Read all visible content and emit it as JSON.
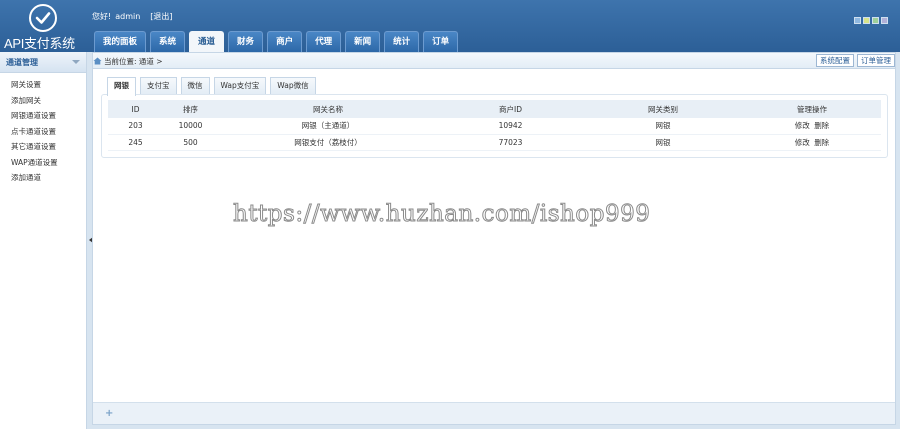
{
  "header": {
    "logo_text": "API支付系统",
    "greeting": "您好!",
    "username": "admin",
    "logout_label": "[退出]",
    "skin_colors": [
      "#8fb8e0",
      "#d8e48a",
      "#9fd09a",
      "#b0b0d8"
    ]
  },
  "nav": {
    "tabs": [
      {
        "label": "我的面板"
      },
      {
        "label": "系统"
      },
      {
        "label": "通道"
      },
      {
        "label": "财务"
      },
      {
        "label": "商户"
      },
      {
        "label": "代理"
      },
      {
        "label": "新闻"
      },
      {
        "label": "统计"
      },
      {
        "label": "订单"
      }
    ],
    "active_index": 2
  },
  "sidebar": {
    "title": "通道管理",
    "items": [
      {
        "label": "网关设置"
      },
      {
        "label": "添加网关"
      },
      {
        "label": "网银通道设置"
      },
      {
        "label": "点卡通道设置"
      },
      {
        "label": "其它通道设置"
      },
      {
        "label": "WAP通道设置"
      },
      {
        "label": "添加通道"
      }
    ]
  },
  "breadcrumb": {
    "text": "当前位置: 通道 >"
  },
  "top_buttons": {
    "system_config": "系统配置",
    "order_manage": "订单管理"
  },
  "tabs": [
    {
      "label": "网银"
    },
    {
      "label": "支付宝"
    },
    {
      "label": "微信"
    },
    {
      "label": "Wap支付宝"
    },
    {
      "label": "Wap微信"
    }
  ],
  "table": {
    "headers": [
      "ID",
      "排序",
      "网关名称",
      "商户ID",
      "网关类别",
      "管理操作"
    ],
    "rows": [
      {
        "id": "203",
        "sort": "10000",
        "name": "网银（主通道）",
        "merchant_id": "10942",
        "category": "网银",
        "edit": "修改",
        "delete": "删除"
      },
      {
        "id": "245",
        "sort": "500",
        "name": "网银支付（荔枝付）",
        "merchant_id": "77023",
        "category": "网银",
        "edit": "修改",
        "delete": "删除"
      }
    ]
  },
  "watermark": "https://www.huzhan.com/ishop999",
  "footer": {
    "plus_symbol": "+"
  }
}
